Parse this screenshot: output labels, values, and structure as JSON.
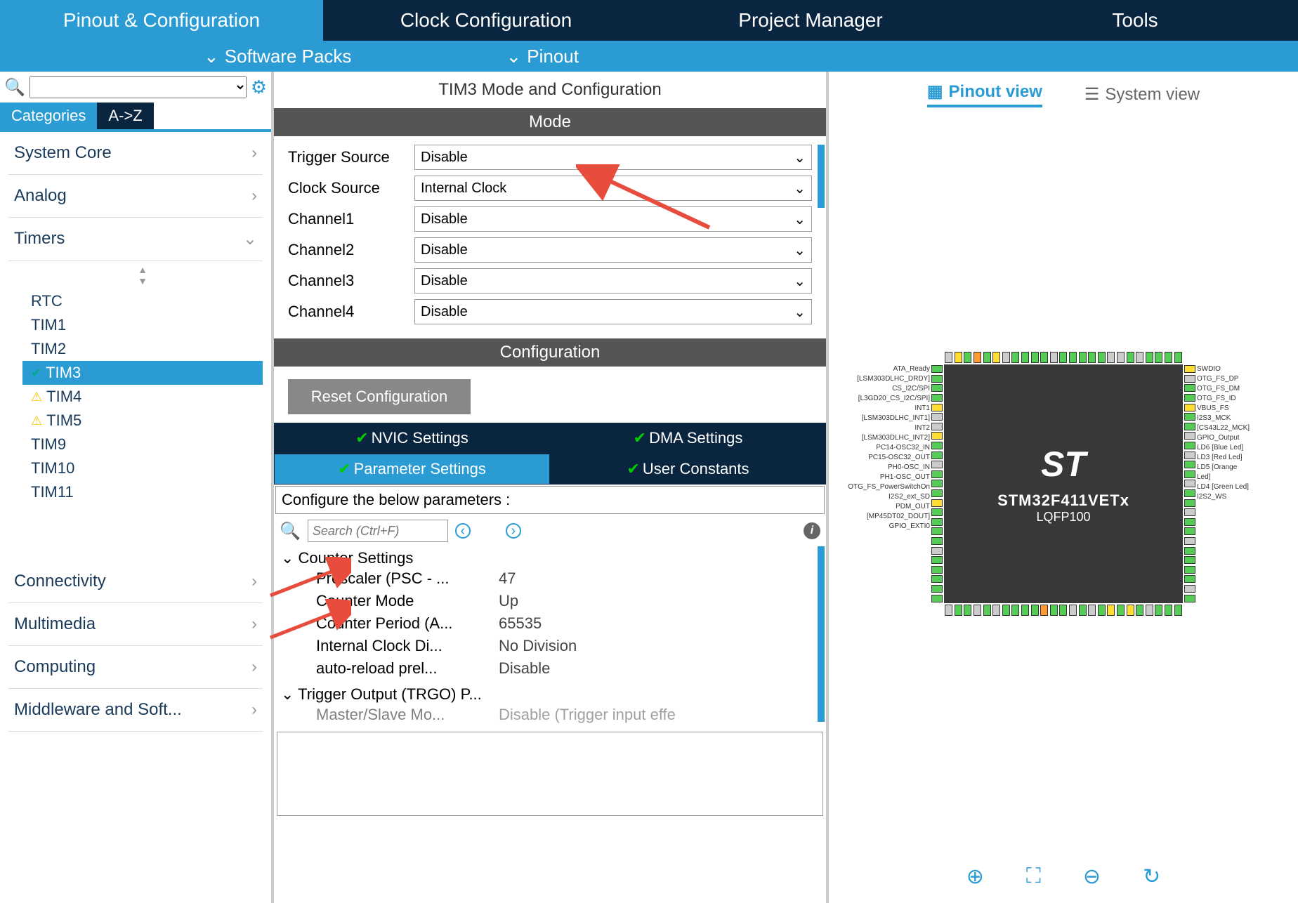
{
  "mainTabs": [
    "Pinout & Configuration",
    "Clock Configuration",
    "Project Manager",
    "Tools"
  ],
  "subTabs": {
    "software": "Software Packs",
    "pinout": "Pinout"
  },
  "catTabs": {
    "categories": "Categories",
    "az": "A->Z"
  },
  "categories": {
    "systemCore": "System Core",
    "analog": "Analog",
    "timers": "Timers",
    "connectivity": "Connectivity",
    "multimedia": "Multimedia",
    "computing": "Computing",
    "middleware": "Middleware and Soft..."
  },
  "timers": {
    "rtc": "RTC",
    "tim1": "TIM1",
    "tim2": "TIM2",
    "tim3": "TIM3",
    "tim4": "TIM4",
    "tim5": "TIM5",
    "tim9": "TIM9",
    "tim10": "TIM10",
    "tim11": "TIM11"
  },
  "center": {
    "title": "TIM3 Mode and Configuration",
    "modeHeader": "Mode",
    "configHeader": "Configuration",
    "resetBtn": "Reset Configuration"
  },
  "mode": {
    "triggerSource": {
      "label": "Trigger Source",
      "value": "Disable"
    },
    "clockSource": {
      "label": "Clock Source",
      "value": "Internal Clock"
    },
    "channel1": {
      "label": "Channel1",
      "value": "Disable"
    },
    "channel2": {
      "label": "Channel2",
      "value": "Disable"
    },
    "channel3": {
      "label": "Channel3",
      "value": "Disable"
    },
    "channel4": {
      "label": "Channel4",
      "value": "Disable"
    }
  },
  "configTabs": {
    "nvic": "NVIC Settings",
    "dma": "DMA Settings",
    "param": "Parameter Settings",
    "user": "User Constants"
  },
  "params": {
    "instruction": "Configure the below parameters :",
    "searchPlaceholder": "Search (Ctrl+F)",
    "counterSettings": "Counter Settings",
    "prescaler": {
      "name": "Prescaler (PSC - ...",
      "value": "47"
    },
    "counterMode": {
      "name": "Counter Mode",
      "value": "Up"
    },
    "counterPeriod": {
      "name": "Counter Period (A...",
      "value": "65535"
    },
    "internalClock": {
      "name": "Internal Clock Di...",
      "value": "No Division"
    },
    "autoReload": {
      "name": "auto-reload prel...",
      "value": "Disable"
    },
    "triggerOutput": "Trigger Output (TRGO) P...",
    "masterSlave": {
      "name": "Master/Slave Mo...",
      "value": "Disable (Trigger input effe"
    }
  },
  "views": {
    "pinout": "Pinout view",
    "system": "System view"
  },
  "chip": {
    "name": "STM32F411VETx",
    "package": "LQFP100"
  },
  "pinLabelsLeft": [
    "ATA_Ready [LSM303DLHC_DRDY]",
    "CS_I2C/SPI [L3GD20_CS_I2C/SPI]",
    "INT1 [LSM303DLHC_INT1]",
    "INT2 [LSM303DLHC_INT2]",
    "",
    "",
    "PC14-OSC32_IN",
    "PC15-OSC32_OUT",
    "",
    "PH0-OSC_IN",
    "PH1-OSC_OUT",
    "OTG_FS_PowerSwitchOn",
    "",
    "I2S2_ext_SD",
    "PDM_OUT [MP45DT02_DOUT]",
    "",
    "",
    "",
    "GPIO_EXTI0",
    ""
  ],
  "pinLabelsRight": [
    "SWDIO",
    "",
    "OTG_FS_DP",
    "OTG_FS_DM",
    "OTG_FS_ID",
    "",
    "VBUS_FS",
    "",
    "",
    "",
    "I2S3_MCK [CS43L22_MCK]",
    "GPIO_Output",
    "LD6 [Blue Led]",
    "LD3 [Red Led]",
    "LD5 [Orange Led]",
    "LD4 [Green Led]",
    "",
    "",
    "",
    "",
    "I2S2_WS"
  ]
}
